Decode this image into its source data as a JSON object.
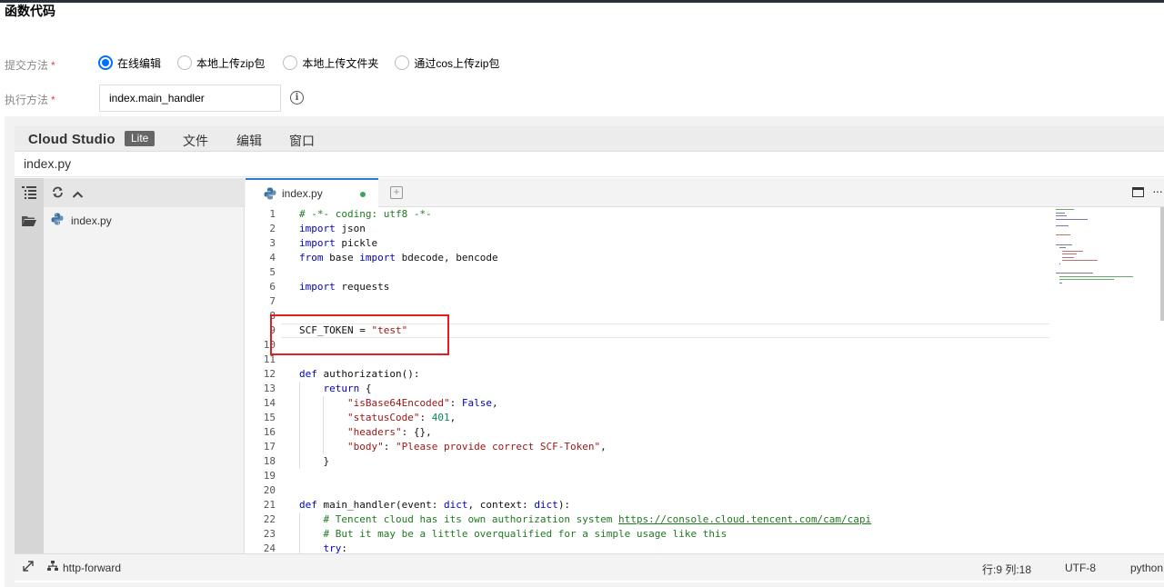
{
  "section_title": "函数代码",
  "form": {
    "submit_label": "提交方法",
    "submit_options": [
      "在线编辑",
      "本地上传zip包",
      "本地上传文件夹",
      "通过cos上传zip包"
    ],
    "submit_selected": "在线编辑",
    "handler_label": "执行方法",
    "handler_value": "index.main_handler",
    "required_mark": "*"
  },
  "ide": {
    "brand": "Cloud Studio",
    "badge": "Lite",
    "menus": [
      "文件",
      "编辑",
      "窗口"
    ],
    "current_file": "index.py",
    "tree_file": "index.py",
    "tab_label": "index.py"
  },
  "code_lines": [
    "# -*- coding: utf8 -*-",
    "import json",
    "import pickle",
    "from base64 import b64decode, b64encode",
    "",
    "import requests",
    "",
    "",
    "SCF_TOKEN = \"test\"",
    "",
    "",
    "def authorization():",
    "    return {",
    "        \"isBase64Encoded\": False,",
    "        \"statusCode\": 401,",
    "        \"headers\": {},",
    "        \"body\": \"Please provide correct SCF-Token\",",
    "    }",
    "",
    "",
    "def main_handler(event: dict, context: dict):",
    "    # Tencent cloud has its own authorization system https://console.cloud.tencent.com/cam/capi",
    "    # But it may be a little overqualified for a simple usage like this",
    "    try:"
  ],
  "status": {
    "left": "http-forward",
    "position": "行:9 列:18",
    "encoding": "UTF-8",
    "language": "python"
  }
}
